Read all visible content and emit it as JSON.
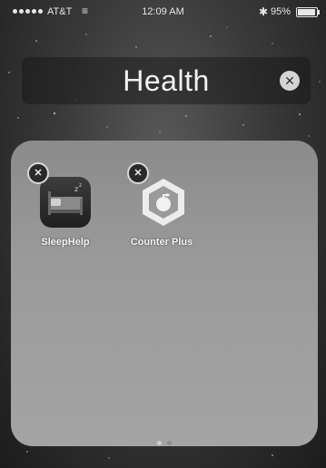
{
  "status_bar": {
    "carrier": "AT&T",
    "wifi_icon": "wifi-icon",
    "time": "12:09 AM",
    "bluetooth_icon": "bluetooth-icon",
    "battery_percent": "95%",
    "battery_level": 0.95
  },
  "folder": {
    "title": "Health",
    "clear_icon": "clear-circle-icon",
    "apps": [
      {
        "label": "SleepHelp",
        "icon": "sleephelp-app-icon",
        "delete_icon": "delete-x-icon"
      },
      {
        "label": "Counter Plus",
        "icon": "counter-plus-app-icon",
        "delete_icon": "delete-x-icon"
      }
    ],
    "page_count": 2,
    "current_page": 1
  }
}
